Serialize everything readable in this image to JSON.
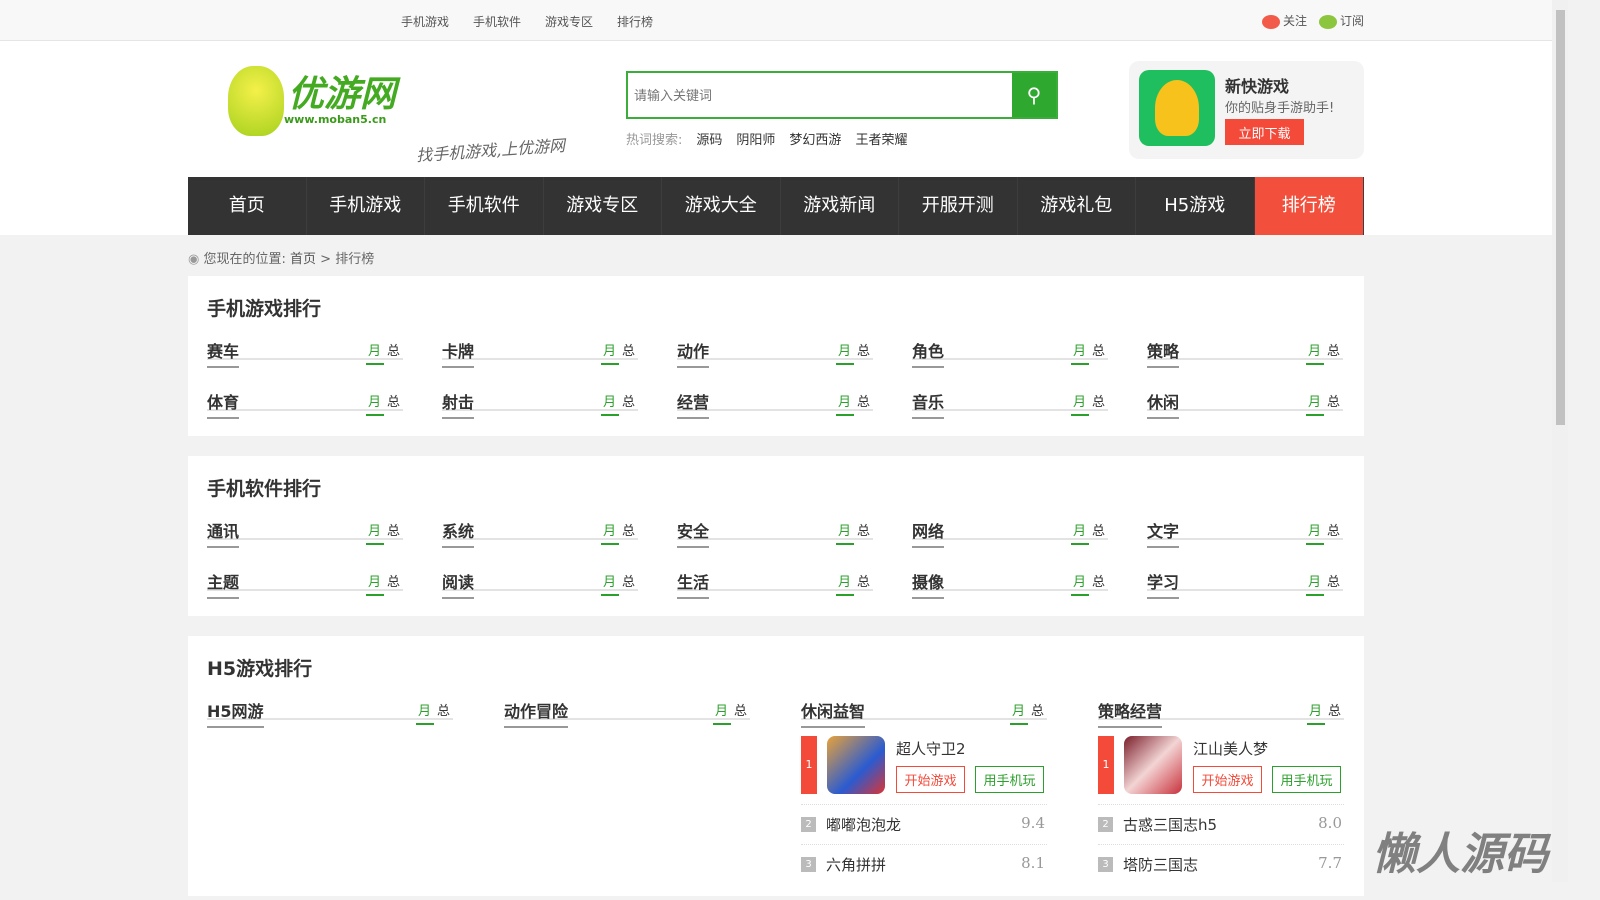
{
  "topbar": {
    "links": [
      "手机游戏",
      "手机软件",
      "游戏专区",
      "排行榜"
    ],
    "follow": "关注",
    "subscribe": "订阅"
  },
  "logo": {
    "name": "优游网",
    "url": "www.moban5.cn",
    "slogan": "找手机游戏,上优游网"
  },
  "search": {
    "placeholder": "请输入关键词",
    "hot_label": "热词搜索:",
    "hot": [
      "源码",
      "阴阳师",
      "梦幻西游",
      "王者荣耀"
    ]
  },
  "app": {
    "title": "新快游戏",
    "subtitle": "你的贴身手游助手!",
    "button": "立即下载"
  },
  "nav": [
    "首页",
    "手机游戏",
    "手机软件",
    "游戏专区",
    "游戏大全",
    "游戏新闻",
    "开服开测",
    "游戏礼包",
    "H5游戏",
    "排行榜"
  ],
  "breadcrumb": {
    "label": "您现在的位置:",
    "home": "首页",
    "sep": ">",
    "current": "排行榜"
  },
  "tabs": {
    "month": "月",
    "total": "总"
  },
  "game_rank": {
    "title": "手机游戏排行",
    "cats": [
      "赛车",
      "卡牌",
      "动作",
      "角色",
      "策略",
      "体育",
      "射击",
      "经营",
      "音乐",
      "休闲"
    ]
  },
  "soft_rank": {
    "title": "手机软件排行",
    "cats": [
      "通讯",
      "系统",
      "安全",
      "网络",
      "文字",
      "主题",
      "阅读",
      "生活",
      "摄像",
      "学习"
    ]
  },
  "h5_rank": {
    "title": "H5游戏排行",
    "cats": [
      {
        "name": "H5网游",
        "items": []
      },
      {
        "name": "动作冒险",
        "items": []
      },
      {
        "name": "休闲益智",
        "top": {
          "rank": "1",
          "name": "超人守卫2",
          "play": "开始游戏",
          "mobile": "用手机玩"
        },
        "items": [
          {
            "rank": "2",
            "name": "嘟嘟泡泡龙",
            "score": "9.4"
          },
          {
            "rank": "3",
            "name": "六角拼拼",
            "score": "8.1"
          }
        ]
      },
      {
        "name": "策略经营",
        "top": {
          "rank": "1",
          "name": "江山美人梦",
          "play": "开始游戏",
          "mobile": "用手机玩"
        },
        "items": [
          {
            "rank": "2",
            "name": "古惑三国志h5",
            "score": "8.0"
          },
          {
            "rank": "3",
            "name": "塔防三国志",
            "score": "7.7"
          }
        ]
      }
    ]
  },
  "watermark": "懒人源码"
}
